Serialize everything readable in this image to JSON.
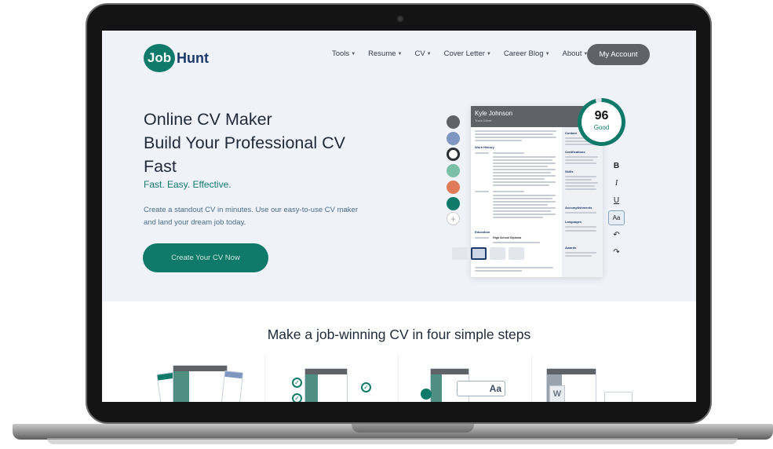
{
  "nav": {
    "logo": {
      "mark": "Job",
      "text": "Hunt"
    },
    "items": [
      {
        "label": "Tools"
      },
      {
        "label": "Resume"
      },
      {
        "label": "CV"
      },
      {
        "label": "Cover Letter"
      },
      {
        "label": "Career Blog"
      },
      {
        "label": "About"
      }
    ],
    "account_label": "My Account"
  },
  "hero": {
    "title_lines": [
      "Online CV Maker",
      "Build Your Professional CV",
      "Fast"
    ],
    "tagline": "Fast. Easy. Effective.",
    "description": "Create a standout CV in minutes. Use our easy-to-use CV maker and land your dream job today.",
    "cta_label": "Create Your CV Now"
  },
  "editor": {
    "swatches": [
      "#5f6368",
      "#7f96c0",
      "#ffffff",
      "#7bbfa8",
      "#e07b5a",
      "#0f7a6a"
    ],
    "selected_swatch": 2,
    "add_swatch": "+",
    "resume": {
      "name": "Kyle Johnson",
      "role": "Truck Driver",
      "sections": {
        "work_history": "Work History",
        "education": "Education",
        "education_item": "High School Diploma",
        "contact": "Contact",
        "certifications": "Certifications",
        "skills": "Skills",
        "accomplishments": "Accomplishments",
        "languages": "Languages",
        "awards": "Awards"
      }
    },
    "score": {
      "value": "96",
      "label": "Good",
      "fraction": 0.96
    },
    "tools": [
      {
        "icon": "bold-icon",
        "glyph": "B"
      },
      {
        "icon": "italic-icon",
        "glyph": "I"
      },
      {
        "icon": "underline-icon",
        "glyph": "U"
      },
      {
        "icon": "spellcheck-icon",
        "glyph": "Aa"
      },
      {
        "icon": "undo-icon",
        "glyph": "↶"
      },
      {
        "icon": "redo-icon",
        "glyph": "↷"
      }
    ]
  },
  "steps": {
    "title": "Make a job-winning CV in four simple steps",
    "aa_glyph": "Aa",
    "w_glyph": "W",
    "check_glyph": "✓"
  },
  "colors": {
    "brand": "#0f7a6a",
    "navy": "#1b3a6b",
    "hero_bg": "#f0f2fa",
    "account": "#5f6368"
  }
}
